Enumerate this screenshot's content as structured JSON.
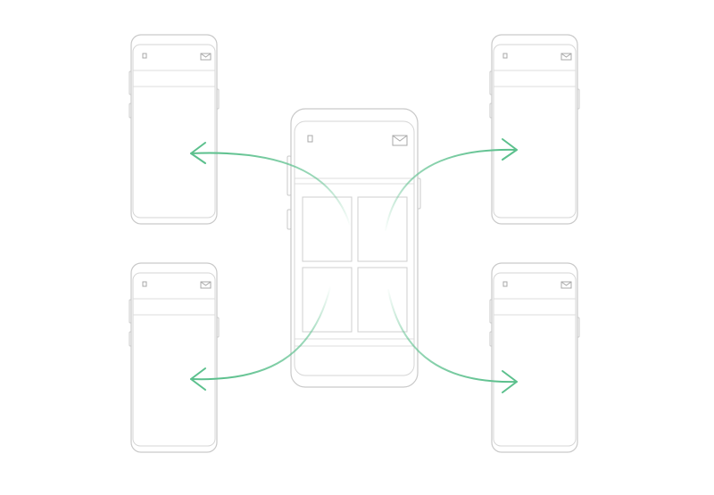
{
  "colors": {
    "arrow": "#5cc08d",
    "outline": "#c9c9c9",
    "background": "#ffffff"
  },
  "diagram": {
    "center_phone": {
      "status_icon": "small-square-icon",
      "mail_icon": "envelope-icon",
      "grid_tiles": 4
    },
    "side_phones": [
      {
        "position": "top-left",
        "status_icon": "small-square-icon",
        "mail_icon": "envelope-icon"
      },
      {
        "position": "top-right",
        "status_icon": "small-square-icon",
        "mail_icon": "envelope-icon"
      },
      {
        "position": "bottom-left",
        "status_icon": "small-square-icon",
        "mail_icon": "envelope-icon"
      },
      {
        "position": "bottom-right",
        "status_icon": "small-square-icon",
        "mail_icon": "envelope-icon"
      }
    ],
    "arrows": [
      {
        "from": "center-phone",
        "to": "top-left"
      },
      {
        "from": "center-phone",
        "to": "top-right"
      },
      {
        "from": "center-phone",
        "to": "bottom-left"
      },
      {
        "from": "center-phone",
        "to": "bottom-right"
      }
    ]
  }
}
